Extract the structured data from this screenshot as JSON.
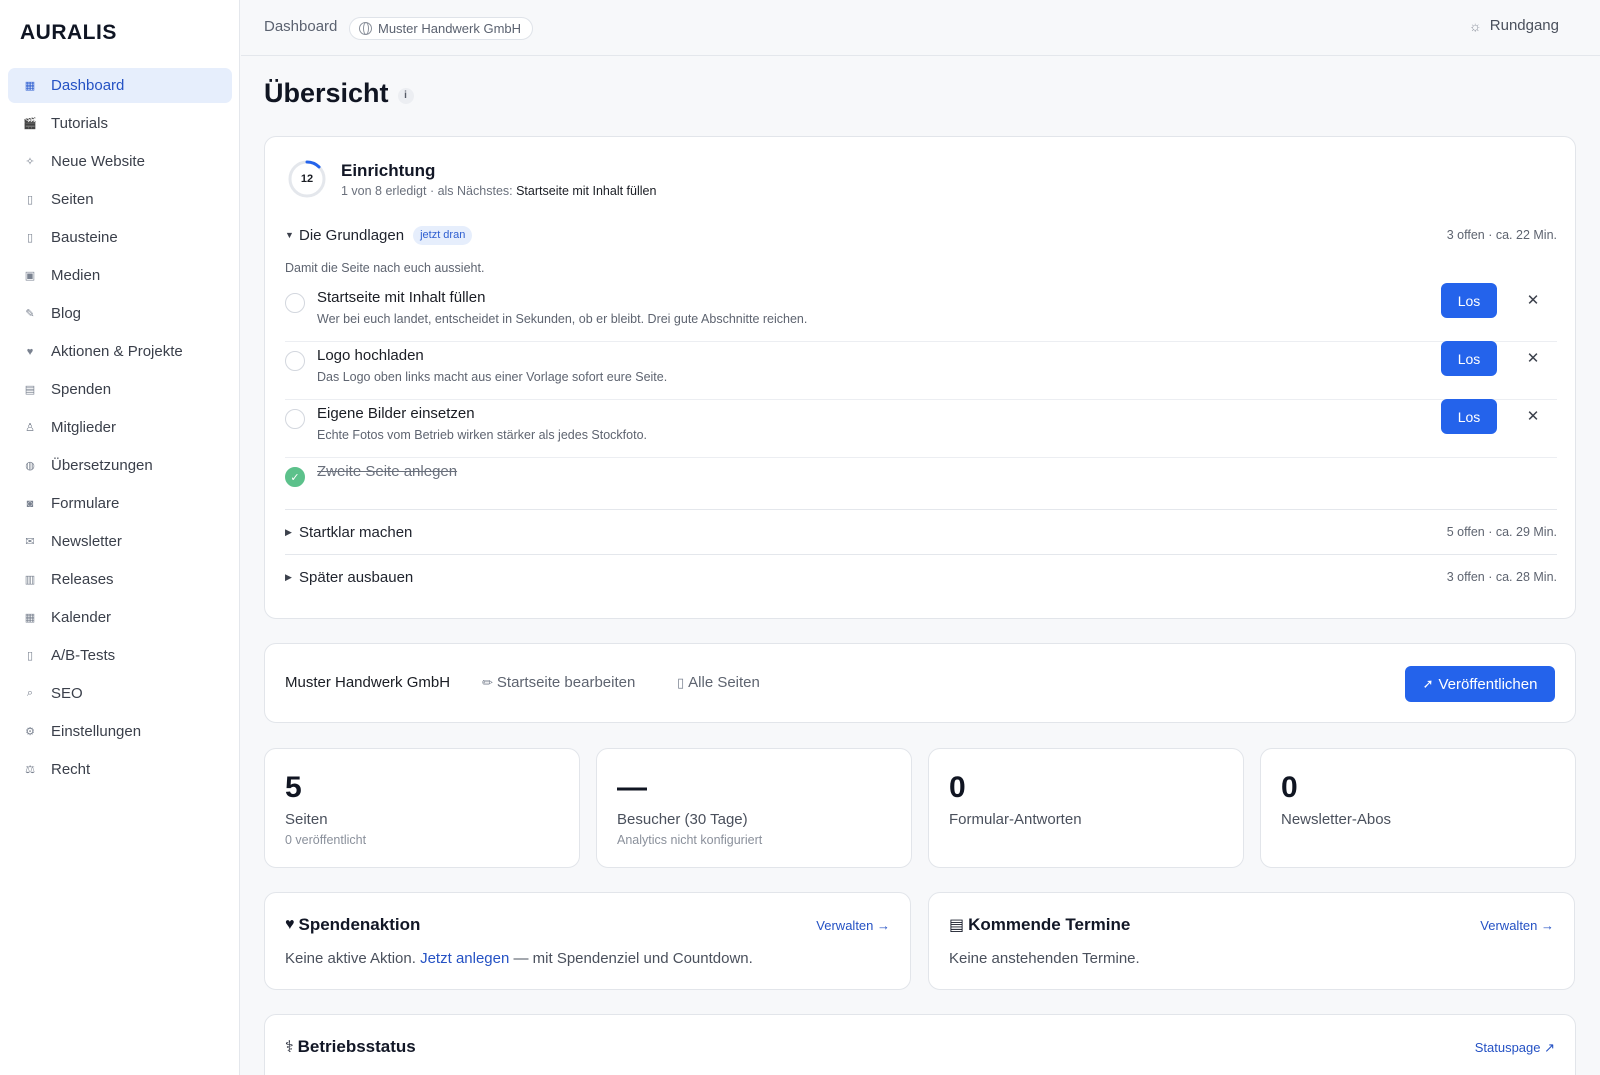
{
  "brand": "AURALIS",
  "nav": [
    {
      "label": "Dashboard",
      "icon": "grid-icon",
      "glyph": "▦",
      "active": true
    },
    {
      "label": "Tutorials",
      "icon": "clapper-icon",
      "glyph": "🎬"
    },
    {
      "label": "Neue Website",
      "icon": "sparkle-icon",
      "glyph": "✧"
    },
    {
      "label": "Seiten",
      "icon": "page-icon",
      "glyph": "▯"
    },
    {
      "label": "Bausteine",
      "icon": "block-icon",
      "glyph": "▯"
    },
    {
      "label": "Medien",
      "icon": "image-icon",
      "glyph": "▣"
    },
    {
      "label": "Blog",
      "icon": "pen-icon",
      "glyph": "✎"
    },
    {
      "label": "Aktionen & Projekte",
      "icon": "heart-icon",
      "glyph": "♥"
    },
    {
      "label": "Spenden",
      "icon": "card-icon",
      "glyph": "▤"
    },
    {
      "label": "Mitglieder",
      "icon": "people-icon",
      "glyph": "♙"
    },
    {
      "label": "Übersetzungen",
      "icon": "globe-icon",
      "glyph": "◍"
    },
    {
      "label": "Formulare",
      "icon": "form-icon",
      "glyph": "◙"
    },
    {
      "label": "Newsletter",
      "icon": "mail-icon",
      "glyph": "✉"
    },
    {
      "label": "Releases",
      "icon": "package-icon",
      "glyph": "▥"
    },
    {
      "label": "Kalender",
      "icon": "calendar-icon",
      "glyph": "▦"
    },
    {
      "label": "A/B-Tests",
      "icon": "test-icon",
      "glyph": "▯"
    },
    {
      "label": "SEO",
      "icon": "magnifier-icon",
      "glyph": "⌕"
    },
    {
      "label": "Einstellungen",
      "icon": "gear-icon",
      "glyph": "⚙"
    },
    {
      "label": "Recht",
      "icon": "scale-icon",
      "glyph": "⚖"
    }
  ],
  "topbar": {
    "breadcrumb": "Dashboard",
    "org": "Muster Handwerk GmbH",
    "tour": "Rundgang"
  },
  "page": {
    "title": "Übersicht"
  },
  "setup": {
    "progress_number": "12",
    "progress_fraction": 0.125,
    "title": "Einrichtung",
    "subtitle_prefix": "1 von 8 erledigt · als Nächstes: ",
    "subtitle_next": "Startseite mit Inhalt füllen",
    "sections": [
      {
        "title": "Die Grundlagen",
        "badge": "jetzt dran",
        "meta": "3 offen · ca. 22 Min.",
        "expanded": true,
        "description": "Damit die Seite nach euch aussieht."
      },
      {
        "title": "Startklar machen",
        "meta": "5 offen · ca. 29 Min.",
        "expanded": false
      },
      {
        "title": "Später ausbauen",
        "meta": "3 offen · ca. 28 Min.",
        "expanded": false
      }
    ],
    "tasks": [
      {
        "title": "Startseite mit Inhalt füllen",
        "desc": "Wer bei euch landet, entscheidet in Sekunden, ob er bleibt. Drei gute Abschnitte reichen.",
        "action": "Los",
        "done": false
      },
      {
        "title": "Logo hochladen",
        "desc": "Das Logo oben links macht aus einer Vorlage sofort eure Seite.",
        "action": "Los",
        "done": false
      },
      {
        "title": "Eigene Bilder einsetzen",
        "desc": "Echte Fotos vom Betrieb wirken stärker als jedes Stockfoto.",
        "action": "Los",
        "done": false
      },
      {
        "title": "Zweite Seite anlegen",
        "done": true
      }
    ],
    "dismiss_glyph": "✕",
    "done_glyph": "✓"
  },
  "sitebar": {
    "name": "Muster Handwerk GmbH",
    "edit_label": "Startseite bearbeiten",
    "pages_label": "Alle Seiten",
    "publish_label": "Veröffentlichen"
  },
  "stats": [
    {
      "value": "5",
      "label": "Seiten",
      "sub": "0 veröffentlicht"
    },
    {
      "value": "—",
      "label": "Besucher (30 Tage)",
      "sub": "Analytics nicht konfiguriert"
    },
    {
      "value": "0",
      "label": "Formular-Antworten",
      "sub": ""
    },
    {
      "value": "0",
      "label": "Newsletter-Abos",
      "sub": ""
    }
  ],
  "donation": {
    "title": "Spendenaktion",
    "link": "Verwalten →",
    "text_before": "Keine aktive Aktion. ",
    "cta": "Jetzt anlegen",
    "text_after": " — mit Spendenziel und Countdown."
  },
  "events": {
    "title": "Kommende Termine",
    "link": "Verwalten →",
    "text": "Keine anstehenden Termine."
  },
  "status": {
    "title": "Betriebsstatus",
    "link": "Statuspage ↗"
  },
  "colors": {
    "accent": "#2463eb",
    "done": "#5cc18b",
    "active_nav_bg": "#e6eefc"
  }
}
